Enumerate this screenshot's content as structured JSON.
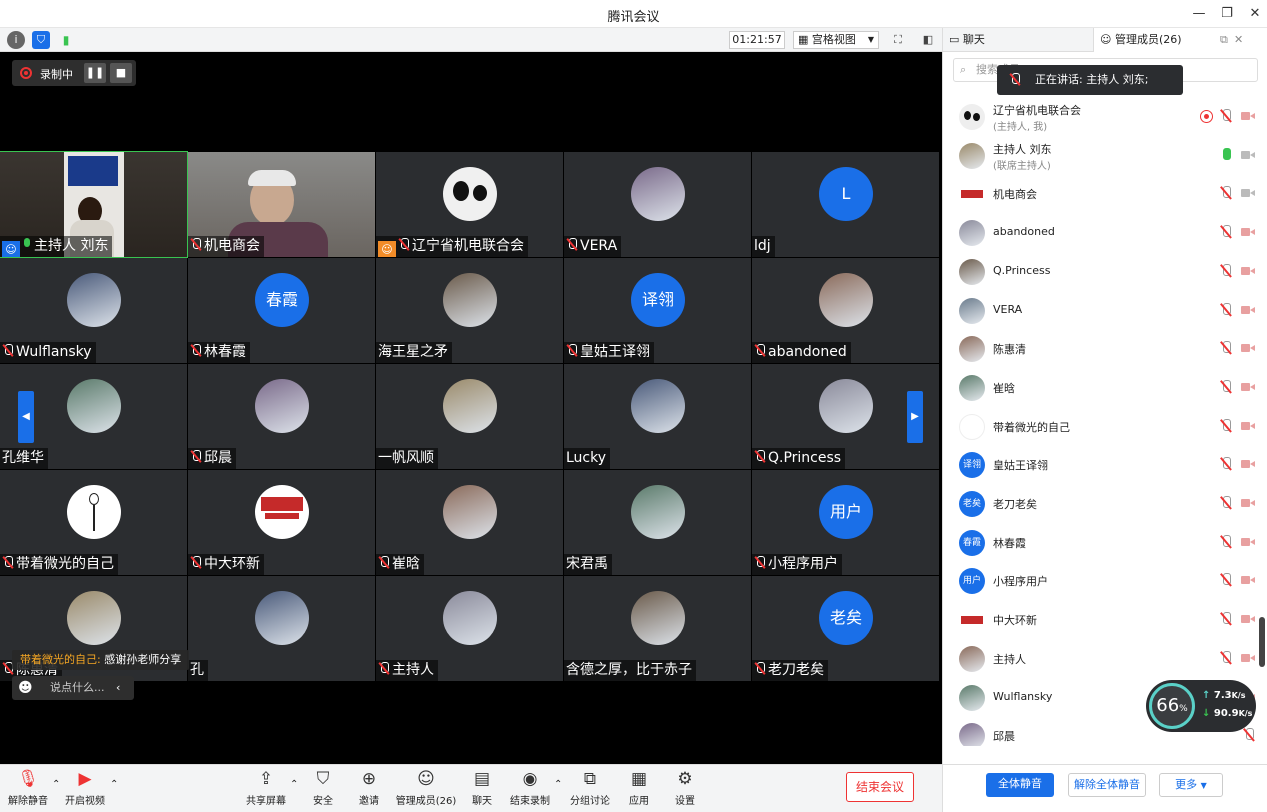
{
  "window": {
    "title": "腾讯会议",
    "controls": [
      "—",
      "❐",
      "✕"
    ]
  },
  "toolbar": {
    "timer": "01:21:57",
    "view_label": "宫格视图"
  },
  "recording": {
    "label": "录制中"
  },
  "tiles": [
    {
      "name": "主持人 刘东",
      "mic": "on",
      "role": "host",
      "avatar": "video-host"
    },
    {
      "name": "机电商会",
      "mic": "off",
      "avatar": "video-man"
    },
    {
      "name": "辽宁省机电联合会",
      "mic": "off",
      "role": "cohost",
      "avatar": "panda"
    },
    {
      "name": "VERA",
      "mic": "off",
      "avatar": "photo"
    },
    {
      "name": "ldj",
      "mic": "none",
      "avatar": "text",
      "avatar_text": "L"
    },
    {
      "name": "Wulflansky",
      "mic": "off",
      "avatar": "photo"
    },
    {
      "name": "林春霞",
      "mic": "off",
      "avatar": "text",
      "avatar_text": "春霞"
    },
    {
      "name": "海王星之矛",
      "mic": "none",
      "avatar": "photo"
    },
    {
      "name": "皇姑王译翎",
      "mic": "off",
      "avatar": "text",
      "avatar_text": "译翎"
    },
    {
      "name": "abandoned",
      "mic": "off",
      "avatar": "photo"
    },
    {
      "name": "孔维华",
      "mic": "none",
      "avatar": "photo"
    },
    {
      "name": "邱晨",
      "mic": "off",
      "avatar": "photo"
    },
    {
      "name": "一帆风顺",
      "mic": "none",
      "avatar": "photo"
    },
    {
      "name": "Lucky",
      "mic": "none",
      "avatar": "photo"
    },
    {
      "name": "Q.Princess",
      "mic": "off",
      "avatar": "photo"
    },
    {
      "name": "带着微光的自己",
      "mic": "off",
      "avatar": "sketch"
    },
    {
      "name": "中大环新",
      "mic": "off",
      "avatar": "logo"
    },
    {
      "name": "崔晗",
      "mic": "off",
      "avatar": "photo"
    },
    {
      "name": "宋君禹",
      "mic": "none",
      "avatar": "photo"
    },
    {
      "name": "小程序用户",
      "mic": "off",
      "avatar": "text",
      "avatar_text": "用户"
    },
    {
      "name": "陈惠清",
      "mic": "off",
      "avatar": "photo"
    },
    {
      "name": "孔",
      "mic": "none",
      "avatar": "photo"
    },
    {
      "name": "主持人",
      "mic": "off",
      "avatar": "photo"
    },
    {
      "name": "含德之厚，比于赤子",
      "mic": "none",
      "avatar": "photo"
    },
    {
      "name": "老刀老矣",
      "mic": "off",
      "avatar": "text",
      "avatar_text": "老矣"
    }
  ],
  "chat": {
    "toast_sender": "带着微光的自己:",
    "toast_message": "感谢孙老师分享",
    "input_placeholder": "说点什么..."
  },
  "bottom": {
    "unmute": "解除静音",
    "start_video": "开启视频",
    "share": "共享屏幕",
    "security": "安全",
    "invite": "邀请",
    "manage": "管理成员(26)",
    "chat": "聊天",
    "end_record": "结束录制",
    "breakout": "分组讨论",
    "apps": "应用",
    "settings": "设置",
    "end_meeting": "结束会议"
  },
  "panel": {
    "tab_chat": "聊天",
    "tab_members": "管理成员(26)",
    "search_placeholder": "搜索成员",
    "speaking": "正在讲话: 主持人 刘东;",
    "members": [
      {
        "name": "辽宁省机电联合会",
        "sub": "(主持人, 我)",
        "mic": "off",
        "cam": "off",
        "rec": true,
        "avatar": "panda"
      },
      {
        "name": "主持人 刘东",
        "sub": "(联席主持人)",
        "mic": "on",
        "cam": "on",
        "avatar": "photo"
      },
      {
        "name": "机电商会",
        "mic": "off",
        "cam": "on",
        "avatar": "logo"
      },
      {
        "name": "abandoned",
        "mic": "off",
        "cam": "off",
        "avatar": "photo"
      },
      {
        "name": "Q.Princess",
        "mic": "off",
        "cam": "off",
        "avatar": "photo"
      },
      {
        "name": "VERA",
        "mic": "off",
        "cam": "off",
        "avatar": "photo"
      },
      {
        "name": "陈惠清",
        "mic": "off",
        "cam": "off",
        "avatar": "photo"
      },
      {
        "name": "崔晗",
        "mic": "off",
        "cam": "off",
        "avatar": "photo"
      },
      {
        "name": "带着微光的自己",
        "mic": "off",
        "cam": "off",
        "avatar": "sketch"
      },
      {
        "name": "皇姑王译翎",
        "mic": "off",
        "cam": "off",
        "avatar": "text",
        "avatar_text": "译翎"
      },
      {
        "name": "老刀老矣",
        "mic": "off",
        "cam": "off",
        "avatar": "text",
        "avatar_text": "老矣"
      },
      {
        "name": "林春霞",
        "mic": "off",
        "cam": "off",
        "avatar": "text",
        "avatar_text": "春霞"
      },
      {
        "name": "小程序用户",
        "mic": "off",
        "cam": "off",
        "avatar": "text",
        "avatar_text": "用户"
      },
      {
        "name": "中大环新",
        "mic": "off",
        "cam": "off",
        "avatar": "logo"
      },
      {
        "name": "主持人",
        "mic": "off",
        "cam": "off",
        "avatar": "photo"
      },
      {
        "name": "Wulflansky",
        "mic": "off",
        "cam": "off",
        "avatar": "photo"
      },
      {
        "name": "邱晨",
        "mic": "off",
        "cam": "none",
        "avatar": "photo"
      }
    ],
    "mute_all": "全体静音",
    "unmute_all": "解除全体静音",
    "more": "更多"
  },
  "network": {
    "score": "66",
    "unit": "%",
    "up": "7.3",
    "up_unit": "K/s",
    "down": "90.9",
    "down_unit": "K/s"
  },
  "colors": {
    "accent": "#1a6fe8",
    "danger": "#e33333",
    "mic_on": "#39c451",
    "tile_bg": "#2b2d30"
  }
}
